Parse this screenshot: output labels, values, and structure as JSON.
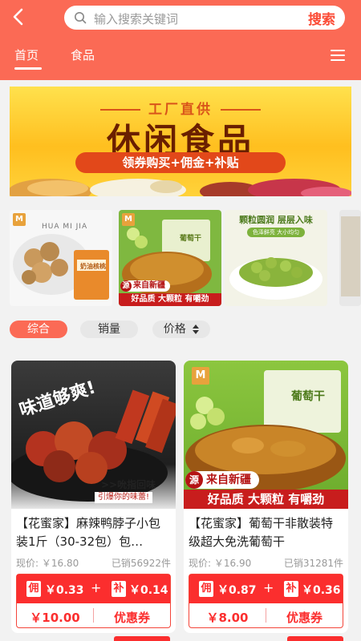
{
  "header": {
    "search_placeholder": "输入搜索关键词",
    "search_button": "搜索",
    "tabs": [
      {
        "label": "首页",
        "active": true
      },
      {
        "label": "食品",
        "active": false
      }
    ]
  },
  "banner": {
    "line1": "工厂直供",
    "line2": "休闲食品",
    "line3": "领券购买+佣金+补贴"
  },
  "strip": {
    "items": [
      {
        "name": "walnuts",
        "overlay": "HUA MI JIA",
        "package_text": "奶油核桃"
      },
      {
        "name": "raisins",
        "package_text": "葡萄干",
        "tag1": "来自新疆",
        "tag2": "好品质 大颗粒 有嚼劲",
        "tag_mark": "源"
      },
      {
        "name": "peas",
        "headline": "颗粒圆润 层层入味",
        "sub": "色泽鲜亮 大小均匀"
      },
      {
        "name": "partial"
      }
    ]
  },
  "filters": {
    "items": [
      {
        "label": "综合",
        "active": true
      },
      {
        "label": "销量",
        "active": false
      },
      {
        "label": "价格",
        "active": false
      }
    ]
  },
  "products": [
    {
      "title": "【花蜜家】麻辣鸭脖子小包装1斤（30-32包）包…",
      "image_text1": "味道够爽!",
      "image_text2": ">>吮指回味",
      "image_text3": "引爆你的味蕾!",
      "price_label": "现价: ￥16.80",
      "sold": "已销56922件",
      "tag_yong": "佣",
      "yong_val": "￥0.33",
      "plus": "+",
      "tag_bu": "补",
      "bu_val": "￥0.14",
      "coupon_amount": "￥10.00",
      "coupon_label": "优惠券"
    },
    {
      "title": "【花蜜家】葡萄干非散装特级超大免洗葡萄干",
      "image_text1": "葡萄干",
      "image_text2": "来自新疆",
      "image_text3": "好品质 大颗粒 有嚼劲",
      "image_mark": "源",
      "price_label": "现价: ￥16.90",
      "sold": "已销31281件",
      "tag_yong": "佣",
      "yong_val": "￥0.87",
      "plus": "+",
      "tag_bu": "补",
      "bu_val": "￥0.36",
      "coupon_amount": "￥8.00",
      "coupon_label": "优惠券"
    }
  ],
  "colors": {
    "header_bg": "#fb6a55",
    "accent_red": "#fb2e2e",
    "active_filter": "#fb6a55"
  }
}
